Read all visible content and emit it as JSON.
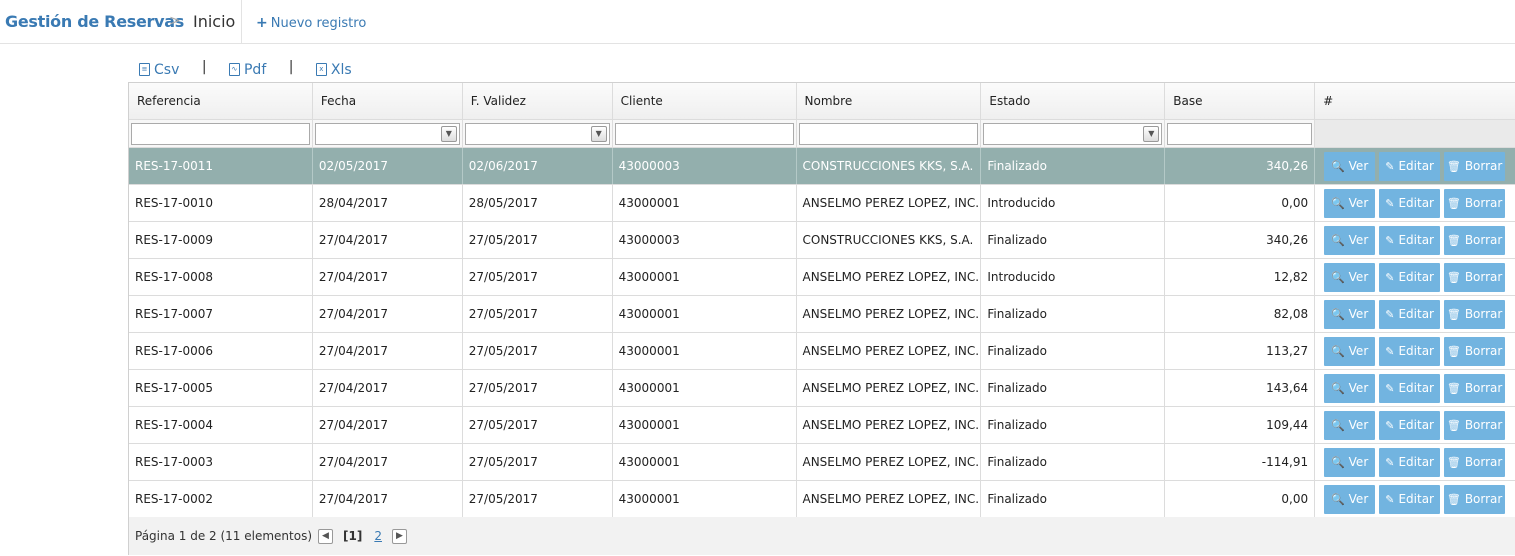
{
  "header": {
    "brand": "Gestión de Reservas",
    "separator": ">",
    "current": "Inicio",
    "new_record_icon": "+",
    "new_record": "Nuevo registro"
  },
  "exports": {
    "csv": "Csv",
    "pdf": "Pdf",
    "xls": "Xls",
    "separator": "|"
  },
  "columns": [
    "Referencia",
    "Fecha",
    "F. Validez",
    "Cliente",
    "Nombre",
    "Estado",
    "Base",
    "#"
  ],
  "buttons": {
    "ver": "Ver",
    "editar": "Editar",
    "borrar": "Borrar"
  },
  "rows": [
    {
      "ref": "RES-17-0011",
      "fecha": "02/05/2017",
      "validez": "02/06/2017",
      "cliente": "43000003",
      "nombre": "CONSTRUCCIONES KKS, S.A.",
      "estado": "Finalizado",
      "base": "340,26",
      "selected": true
    },
    {
      "ref": "RES-17-0010",
      "fecha": "28/04/2017",
      "validez": "28/05/2017",
      "cliente": "43000001",
      "nombre": "ANSELMO PEREZ LOPEZ, INC.",
      "estado": "Introducido",
      "base": "0,00"
    },
    {
      "ref": "RES-17-0009",
      "fecha": "27/04/2017",
      "validez": "27/05/2017",
      "cliente": "43000003",
      "nombre": "CONSTRUCCIONES KKS, S.A.",
      "estado": "Finalizado",
      "base": "340,26"
    },
    {
      "ref": "RES-17-0008",
      "fecha": "27/04/2017",
      "validez": "27/05/2017",
      "cliente": "43000001",
      "nombre": "ANSELMO PEREZ LOPEZ, INC.",
      "estado": "Introducido",
      "base": "12,82"
    },
    {
      "ref": "RES-17-0007",
      "fecha": "27/04/2017",
      "validez": "27/05/2017",
      "cliente": "43000001",
      "nombre": "ANSELMO PEREZ LOPEZ, INC.",
      "estado": "Finalizado",
      "base": "82,08"
    },
    {
      "ref": "RES-17-0006",
      "fecha": "27/04/2017",
      "validez": "27/05/2017",
      "cliente": "43000001",
      "nombre": "ANSELMO PEREZ LOPEZ, INC.",
      "estado": "Finalizado",
      "base": "113,27"
    },
    {
      "ref": "RES-17-0005",
      "fecha": "27/04/2017",
      "validez": "27/05/2017",
      "cliente": "43000001",
      "nombre": "ANSELMO PEREZ LOPEZ, INC.",
      "estado": "Finalizado",
      "base": "143,64"
    },
    {
      "ref": "RES-17-0004",
      "fecha": "27/04/2017",
      "validez": "27/05/2017",
      "cliente": "43000001",
      "nombre": "ANSELMO PEREZ LOPEZ, INC.",
      "estado": "Finalizado",
      "base": "109,44"
    },
    {
      "ref": "RES-17-0003",
      "fecha": "27/04/2017",
      "validez": "27/05/2017",
      "cliente": "43000001",
      "nombre": "ANSELMO PEREZ LOPEZ, INC.",
      "estado": "Finalizado",
      "base": "-114,91"
    },
    {
      "ref": "RES-17-0002",
      "fecha": "27/04/2017",
      "validez": "27/05/2017",
      "cliente": "43000001",
      "nombre": "ANSELMO PEREZ LOPEZ, INC.",
      "estado": "Finalizado",
      "base": "0,00"
    }
  ],
  "pager": {
    "summary": "Página 1 de 2 (11 elementos)",
    "current": "[1]",
    "next_page": "2"
  },
  "colors": {
    "brand": "#3a7ab3",
    "selected_row": "#93afad",
    "action_button": "#72b4e0"
  }
}
